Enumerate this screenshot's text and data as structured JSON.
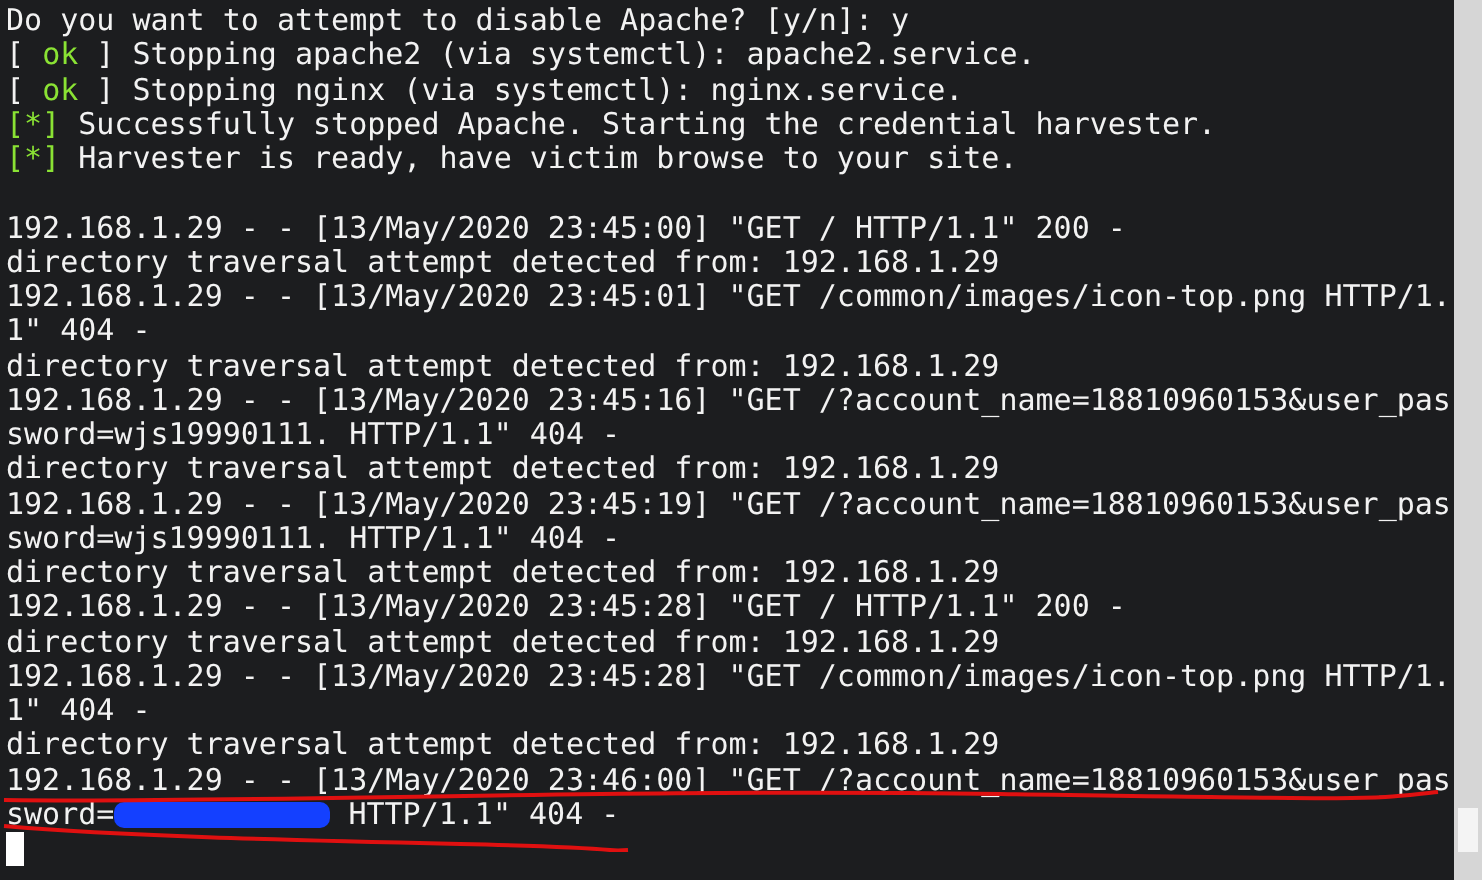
{
  "terminal": {
    "lines": [
      {
        "kind": "text",
        "segments": [
          {
            "kind": "plain",
            "text": "Do you want to attempt to disable Apache? [y/n]: y"
          }
        ]
      },
      {
        "kind": "text",
        "segments": [
          {
            "kind": "plain",
            "text": "[ "
          },
          {
            "kind": "ok",
            "text": "ok"
          },
          {
            "kind": "plain",
            "text": " ] Stopping apache2 (via systemctl): apache2.service."
          }
        ]
      },
      {
        "kind": "text",
        "segments": [
          {
            "kind": "plain",
            "text": "[ "
          },
          {
            "kind": "ok",
            "text": "ok"
          },
          {
            "kind": "plain",
            "text": " ] Stopping nginx (via systemctl): nginx.service."
          }
        ]
      },
      {
        "kind": "text",
        "segments": [
          {
            "kind": "ok",
            "text": "[*]"
          },
          {
            "kind": "plain",
            "text": " Successfully stopped Apache. Starting the credential harvester."
          }
        ]
      },
      {
        "kind": "text",
        "segments": [
          {
            "kind": "ok",
            "text": "[*]"
          },
          {
            "kind": "plain",
            "text": " Harvester is ready, have victim browse to your site."
          }
        ]
      },
      {
        "kind": "blank"
      },
      {
        "kind": "text",
        "segments": [
          {
            "kind": "plain",
            "text": "192.168.1.29 - - [13/May/2020 23:45:00] \"GET / HTTP/1.1\" 200 -"
          }
        ]
      },
      {
        "kind": "text",
        "segments": [
          {
            "kind": "plain",
            "text": "directory traversal attempt detected from: 192.168.1.29"
          }
        ]
      },
      {
        "kind": "text",
        "segments": [
          {
            "kind": "plain",
            "text": "192.168.1.29 - - [13/May/2020 23:45:01] \"GET /common/images/icon-top.png HTTP/1."
          }
        ]
      },
      {
        "kind": "text",
        "segments": [
          {
            "kind": "plain",
            "text": "1\" 404 -"
          }
        ]
      },
      {
        "kind": "text",
        "segments": [
          {
            "kind": "plain",
            "text": "directory traversal attempt detected from: 192.168.1.29"
          }
        ]
      },
      {
        "kind": "text",
        "segments": [
          {
            "kind": "plain",
            "text": "192.168.1.29 - - [13/May/2020 23:45:16] \"GET /?account_name=18810960153&user_pas"
          }
        ]
      },
      {
        "kind": "text",
        "segments": [
          {
            "kind": "plain",
            "text": "sword=wjs19990111. HTTP/1.1\" 404 -"
          }
        ]
      },
      {
        "kind": "text",
        "segments": [
          {
            "kind": "plain",
            "text": "directory traversal attempt detected from: 192.168.1.29"
          }
        ]
      },
      {
        "kind": "text",
        "segments": [
          {
            "kind": "plain",
            "text": "192.168.1.29 - - [13/May/2020 23:45:19] \"GET /?account_name=18810960153&user_pas"
          }
        ]
      },
      {
        "kind": "text",
        "segments": [
          {
            "kind": "plain",
            "text": "sword=wjs19990111. HTTP/1.1\" 404 -"
          }
        ]
      },
      {
        "kind": "text",
        "segments": [
          {
            "kind": "plain",
            "text": "directory traversal attempt detected from: 192.168.1.29"
          }
        ]
      },
      {
        "kind": "text",
        "segments": [
          {
            "kind": "plain",
            "text": "192.168.1.29 - - [13/May/2020 23:45:28] \"GET / HTTP/1.1\" 200 -"
          }
        ]
      },
      {
        "kind": "text",
        "segments": [
          {
            "kind": "plain",
            "text": "directory traversal attempt detected from: 192.168.1.29"
          }
        ]
      },
      {
        "kind": "text",
        "segments": [
          {
            "kind": "plain",
            "text": "192.168.1.29 - - [13/May/2020 23:45:28] \"GET /common/images/icon-top.png HTTP/1."
          }
        ]
      },
      {
        "kind": "text",
        "segments": [
          {
            "kind": "plain",
            "text": "1\" 404 -"
          }
        ]
      },
      {
        "kind": "text",
        "segments": [
          {
            "kind": "plain",
            "text": "directory traversal attempt detected from: 192.168.1.29"
          }
        ]
      },
      {
        "kind": "text",
        "segments": [
          {
            "kind": "plain",
            "text": "192.168.1.29 - - [13/May/2020 23:46:00] \"GET /?account_name=18810960153&user_pas"
          }
        ]
      },
      {
        "kind": "text",
        "segments": [
          {
            "kind": "plain",
            "text": "sword="
          },
          {
            "kind": "redacted"
          },
          {
            "kind": "plain",
            "text": " HTTP/1.1\" 404 -"
          }
        ]
      },
      {
        "kind": "cursor"
      }
    ]
  }
}
